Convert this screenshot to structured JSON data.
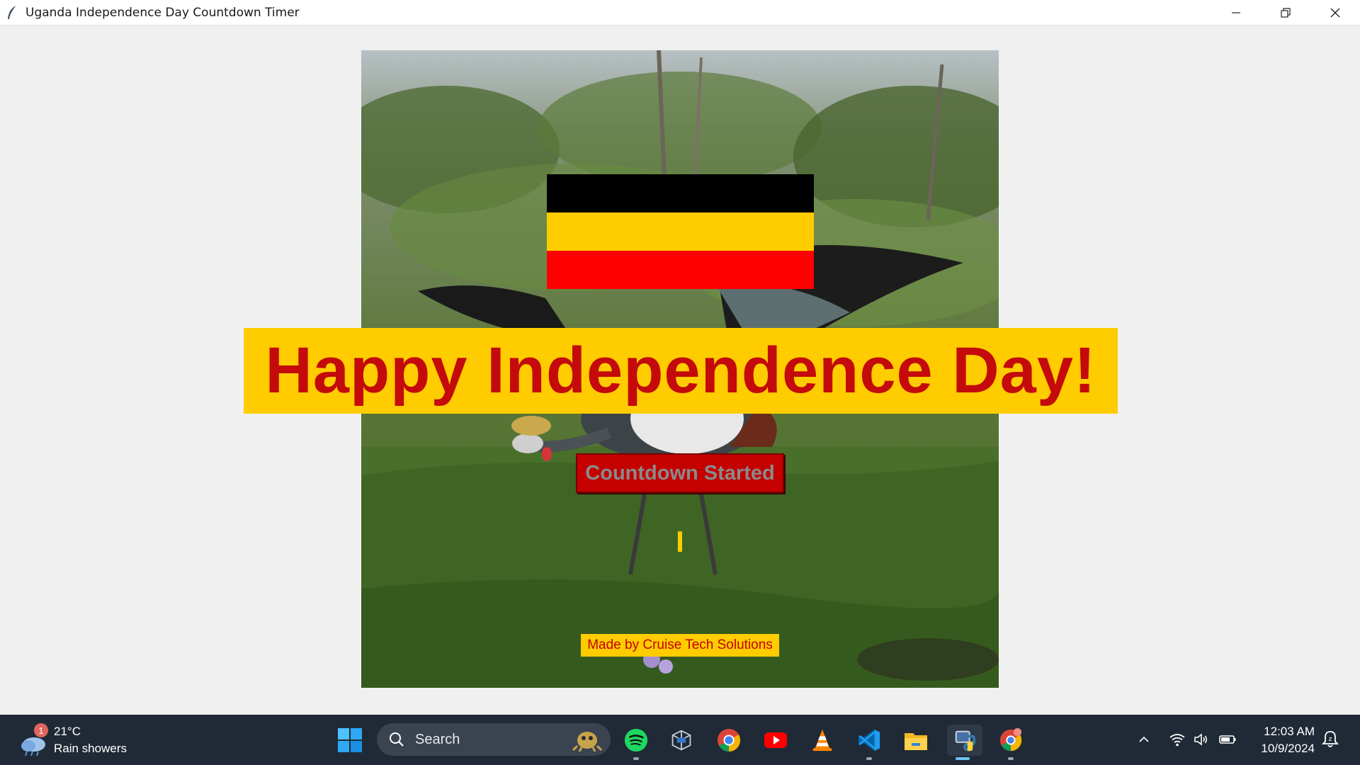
{
  "window": {
    "title": "Uganda Independence Day Countdown Timer",
    "controls": [
      "minimize",
      "restore",
      "close"
    ]
  },
  "app": {
    "headline": "Happy Independence Day!",
    "countdown_button": "Countdown Started",
    "timer_text": "I",
    "credit": "Made by Cruise Tech Solutions",
    "flag_colors": [
      "#000000",
      "#ffcc00",
      "#ff0000"
    ],
    "banner_color": "#ffcc00",
    "headline_color": "#c40a0a"
  },
  "taskbar": {
    "weather": {
      "temperature": "21°C",
      "condition": "Rain showers",
      "badge": "1"
    },
    "search_placeholder": "Search",
    "apps": [
      "windows-start-icon",
      "spotify-icon",
      "virtualbox-icon",
      "chrome-icon",
      "youtube-icon",
      "vlc-icon",
      "vscode-icon",
      "file-explorer-icon",
      "python-icon",
      "chrome-profile-icon"
    ],
    "time": "12:03 AM",
    "date": "10/9/2024"
  }
}
